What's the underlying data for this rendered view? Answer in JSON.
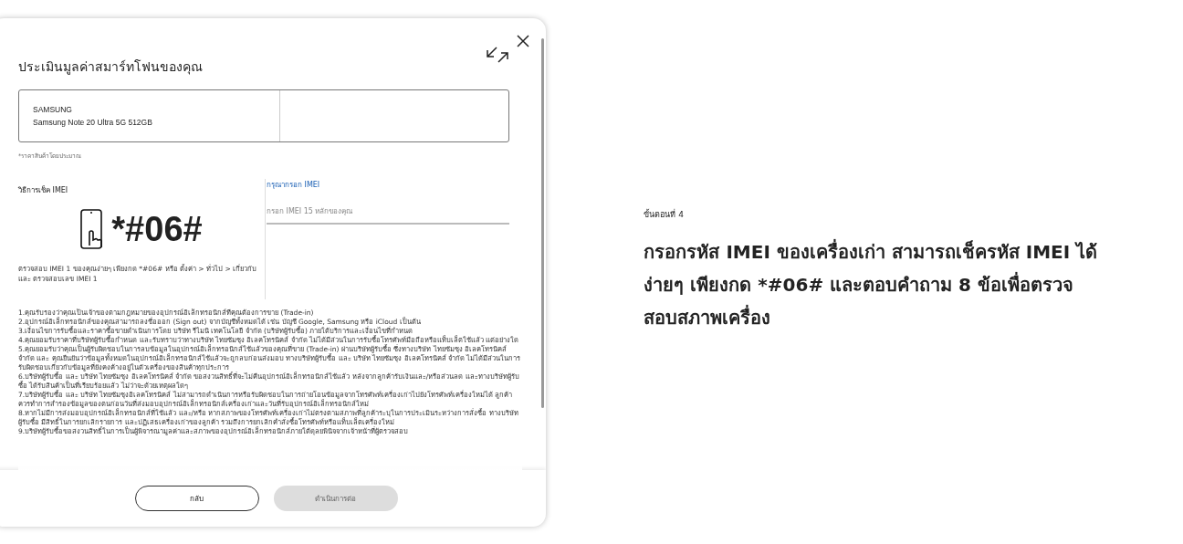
{
  "dialog": {
    "title": "ประเมินมูลค่าสมาร์ทโฟนของคุณ",
    "device": {
      "brand": "SAMSUNG",
      "model": "Samsung Note 20 Ultra 5G 512GB"
    },
    "price_note": "*ราคาสินค้าโดยประมาณ",
    "imei_help": {
      "title": "วิธีการเช็ค IMEI",
      "code": "*#06#",
      "description": "ตรวจสอบ IMEI 1 ของคุณง่ายๆ เพียงกด *#06# หรือ ตั้งค่า > ทั่วไป > เกี่ยวกับ และ ตรวจสอบเลข IMEI 1"
    },
    "imei_input": {
      "label": "กรุณากรอก IMEI",
      "placeholder": "กรอก IMEI 15 หลักของคุณ"
    },
    "terms": [
      "1.คุณรับรองว่าคุณเป็นเจ้าของตามกฎหมายของอุปกรณ์อิเล็กทรอนิกส์ที่คุณต้องการขาย (Trade-in)",
      "2.อุปกรณ์อิเล็กทรอนิกส์ของคุณสามารถลงชื่อออก (Sign out) จากบัญชีทั้งหมดได้ เช่น บัญชี Google, Samsung หรือ iCloud เป็นต้น",
      "3.เงื่อนไขการรับซื้อและราคาซื้อขายดำเนินการโดย บริษัท รีไมนิ เทคโนโลยี จำกัด (บริษัทผู้รับซื้อ) ภายใต้บริการและเงื่อนไขที่กำหนด",
      "4.คุณยอมรับราคาที่บริษัทผู้รับซื้อกำหนด และรับทราบว่าทางบริษัท ไทยซัมซุง อิเลคโทรนิคส์ จำกัด ไม่ได้มีส่วนในการรับซื้อโทรศัพท์มือถือหรือแท็บเล็ตใช้แล้ว แต่อย่างใด",
      "5.คุณยอมรับว่าคุณเป็นผู้รับผิดชอบในการลบข้อมูลในอุปกรณ์อิเล็กทรอนิกส์ใช้แล้วของคุณที่ขาย (Trade-in) ผ่านบริษัทผู้รับซื้อ ซึ่งทางบริษัท ไทยซัมซุง อิเลคโทรนิคส์ จำกัด และ คุณยืนยันว่าข้อมูลทั้งหมดในอุปกรณ์อิเล็กทรอนิกส์ใช้แล้วจะถูกลบก่อนส่งมอบ ทางบริษัทผู้รับซื้อ และ บริษัท ไทยซัมซุง อิเลคโทรนิคส์ จำกัด ไม่ได้มีส่วนในการรับผิดชอบเกี่ยวกับข้อมูลที่ยังคงค้างอยู่ในตัวเครื่องของสินค้าทุกประการ",
      "6.บริษัทผู้รับซื้อ และ บริษัท ไทยซัมซุง อิเลคโทรนิคส์ จำกัด ขอสงวนสิทธิ์ที่จะไม่คืนอุปกรณ์อิเล็กทรอนิกส์ใช้แล้ว หลังจากลูกค้ารับเงินและ/หรือส่วนลด และทางบริษัทผู้รับซื้อ ได้รับสินค้าเป็นที่เรียบร้อยแล้ว ไม่ว่าจะด้วยเหตุผลใดๆ",
      "7.บริษัทผู้รับซื้อ และ บริษัท ไทยซัมซุงอิเลคโทรนิคส์ ไม่สามารถดำเนินการหรือรับผิดชอบในการถ่ายโอนข้อมูลจากโทรศัพท์เครื่องเก่าไปยังโทรศัพท์เครื่องใหม่ได้ ลูกค้าควรทำการสำรองข้อมูลของตนก่อนวันที่ส่งมอบอุปกรณ์อิเล็กทรอนิกส์เครื่องเก่าและวันที่รับอุปกรณ์อิเล็กทรอนิกส์ใหม่",
      "8.หากไม่มีการส่งมอบอุปกรณ์อิเล็กทรอนิกส์ที่ใช้แล้ว และ/หรือ หากสภาพของโทรศัพท์เครื่องเก่าไม่ตรงตามสภาพที่ลูกค้าระบุในการประเมินระหว่างการสั่งซื้อ ทางบริษัทผู้รับซื้อ มีสิทธิ์ในการยกเลิกรายการ และปฏิเสธเครื่องเก่าของลูกค้า รวมถึงการยกเลิกคำสั่งซื้อโทรศัพท์หรือแท็บเล็ตเครื่องใหม่",
      "9.บริษัทผู้รับซื้อขอสงวนสิทธิ์ในการเป็นผู้พิจารณามูลค่าและสภาพของอุปกรณ์อิเล็กทรอนิกส์ภายใต้ดุลยพินิจจากเจ้าหน้าที่ผู้ตรวจสอบ"
    ],
    "buttons": [
      {
        "label": "กลับ",
        "kind": "secondary",
        "disabled": false
      },
      {
        "label": "ดำเนินการต่อ",
        "kind": "primary",
        "disabled": true
      }
    ]
  },
  "step": {
    "label": "ขั้นตอนที่ 4",
    "heading": "กรอกรหัส IMEI ของเครื่องเก่า สามารถเช็ครหัส IMEI ได้ง่ายๆ เพียงกด *#06# และตอบคำถาม 8 ข้อเพื่อตรวจสอบสภาพเครื่อง"
  }
}
